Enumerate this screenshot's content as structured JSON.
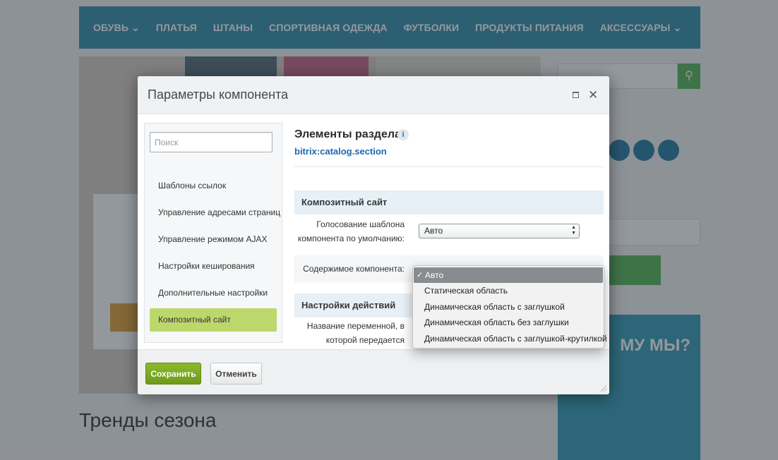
{
  "background": {
    "nav": [
      "ОБУВЬ ⌄",
      "ПЛАТЬЯ",
      "ШТАНЫ",
      "СПОРТИВНАЯ ОДЕЖДА",
      "ФУТБОЛКИ",
      "ПРОДУКТЫ ПИТАНИЯ",
      "АКСЕССУАРЫ ⌄"
    ],
    "trends": "Тренды сезона",
    "why": "МУ МЫ?"
  },
  "modal": {
    "title": "Параметры компонента",
    "sidebar": {
      "search_placeholder": "Поиск",
      "items": [
        {
          "label": "Шаблоны ссылок"
        },
        {
          "label": "Управление адресами страниц"
        },
        {
          "label": "Управление режимом AJAX"
        },
        {
          "label": "Настройки кеширования"
        },
        {
          "label": "Дополнительные настройки"
        },
        {
          "label": "Композитный сайт",
          "active": true
        }
      ]
    },
    "content": {
      "title": "Элементы раздела",
      "subtitle": "bitrix:catalog.section",
      "section1": "Композитный сайт",
      "field1_label": "Голосование шаблона компонента по умолчанию:",
      "field1_value": "Авто",
      "field2_label": "Содержимое компонента:",
      "section2": "Настройки действий",
      "field3_label": "Название переменной, в которой передается действие:"
    },
    "dropdown": {
      "options": [
        "Авто",
        "Статическая область",
        "Динамическая область с заглушкой",
        "Динамическая область без заглушки",
        "Динамическая область с заглушкой-крутилкой"
      ],
      "selected_index": 0
    },
    "footer": {
      "save_label": "Сохранить",
      "cancel_label": "Отменить"
    }
  }
}
